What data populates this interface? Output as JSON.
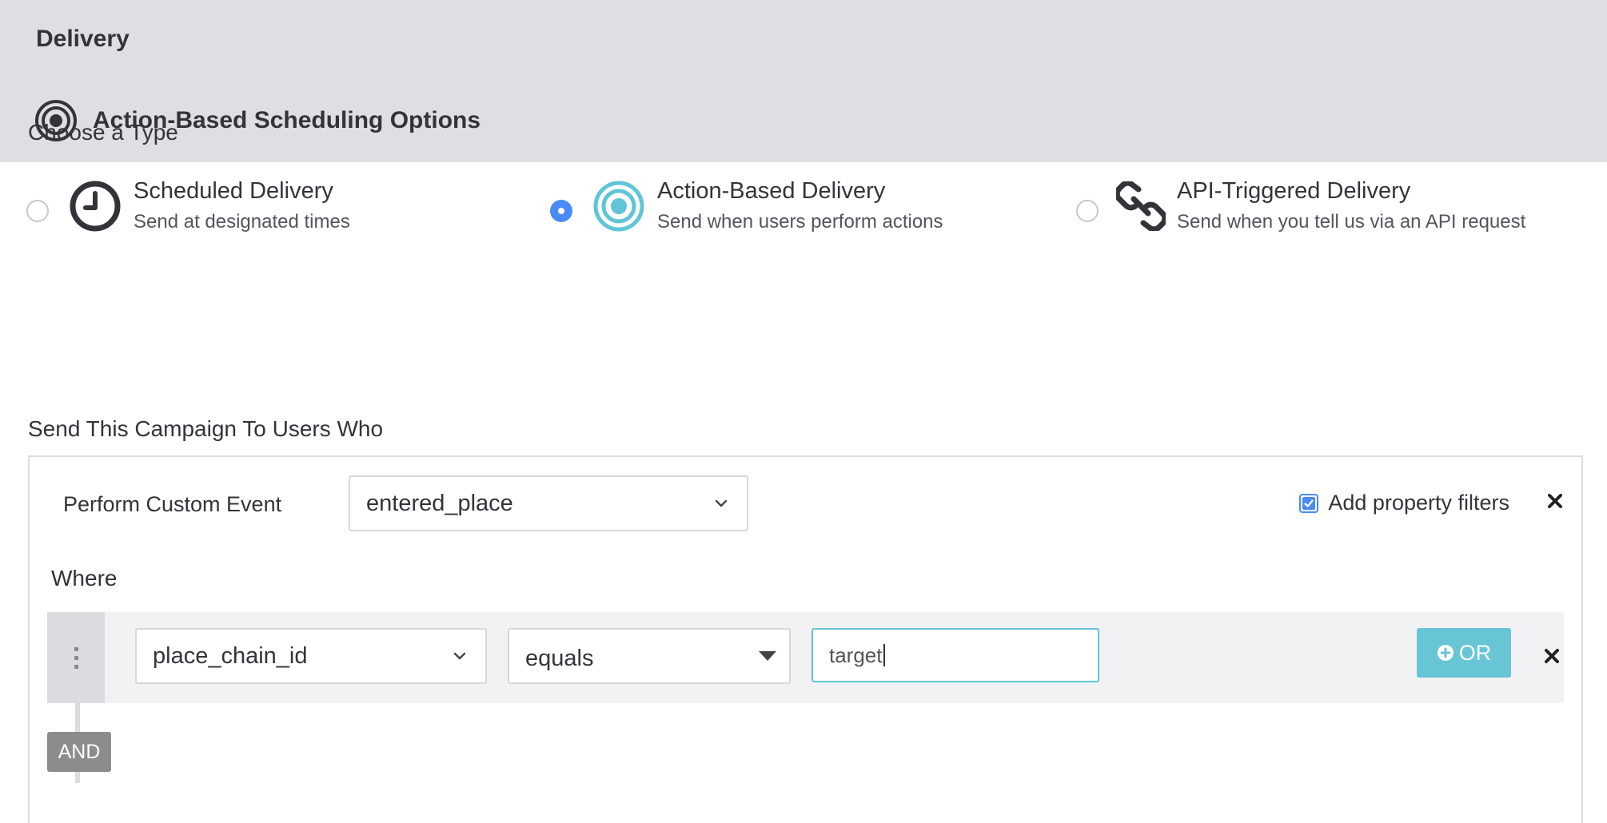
{
  "delivery_header": {
    "title": "Delivery"
  },
  "type_section": {
    "label": "Choose a Type",
    "options": [
      {
        "title": "Scheduled Delivery",
        "subtitle": "Send at designated times",
        "selected": false,
        "icon": "clock-icon"
      },
      {
        "title": "Action-Based Delivery",
        "subtitle": "Send when users perform actions",
        "selected": true,
        "icon": "target-icon"
      },
      {
        "title": "API-Triggered Delivery",
        "subtitle": "Send when you tell us via an API request",
        "selected": false,
        "icon": "link-icon"
      }
    ]
  },
  "action_header": {
    "title": "Action-Based Scheduling Options",
    "icon": "target-icon"
  },
  "trigger": {
    "label": "Send This Campaign To Users Who",
    "event_label": "Perform Custom Event",
    "event_value": "entered_place",
    "add_filters_label": "Add property filters",
    "add_filters_checked": true,
    "where_label": "Where",
    "filter": {
      "property": "place_chain_id",
      "operator": "equals",
      "value": "target"
    },
    "or_label": "OR",
    "and_label": "AND"
  },
  "colors": {
    "header_bg": "#dfdee3",
    "accent_blue": "#4a8af4",
    "accent_teal": "#67c5d6",
    "text": "#34333a"
  }
}
